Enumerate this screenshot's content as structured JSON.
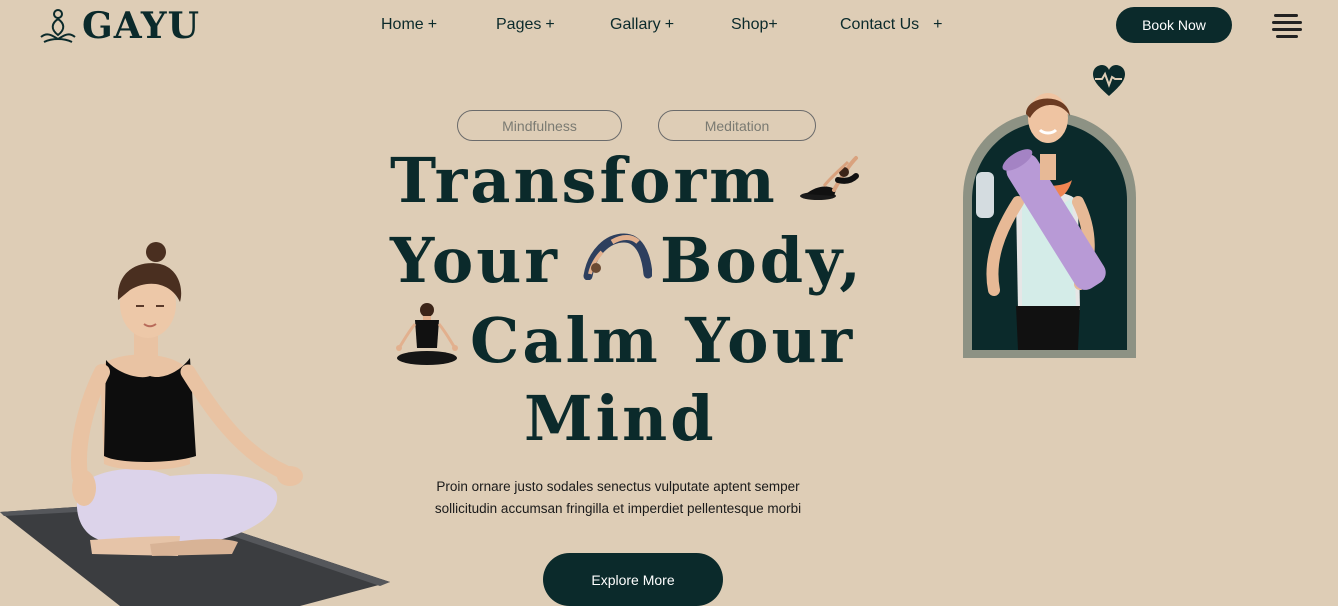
{
  "brand": {
    "name": "GAYU",
    "logo_icon": "lotus-meditation-icon"
  },
  "nav": {
    "items": [
      {
        "label": "Home",
        "suffix": "+"
      },
      {
        "label": "Pages",
        "suffix": "+"
      },
      {
        "label": "Gallary",
        "suffix": "+"
      },
      {
        "label": "Shop",
        "suffix": "+"
      },
      {
        "label": "Contact Us",
        "suffix": "+"
      }
    ],
    "cta_label": "Book Now",
    "menu_icon": "hamburger-menu-icon"
  },
  "hero": {
    "tags": [
      "Mindfulness",
      "Meditation"
    ],
    "headline": {
      "line1": "Transform",
      "line2a": "Your",
      "line2b": "Body,",
      "line3": "Calm Your",
      "line4": "Mind"
    },
    "description_line1": "Proin ornare justo sodales senectus vulputate aptent semper",
    "description_line2": "sollicitudin accumsan fringilla et imperdiet pellentesque morbi",
    "cta_label": "Explore More"
  },
  "colors": {
    "background": "#decdb6",
    "primary": "#0b2a2b",
    "arch_border": "#8d9284",
    "mat_purple": "#b89ad6"
  },
  "icons": [
    "heart-pulse-icon"
  ]
}
